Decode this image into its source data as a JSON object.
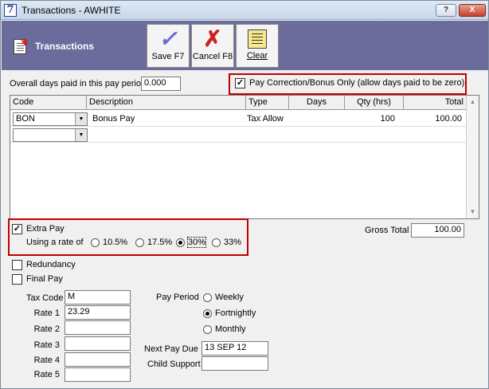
{
  "window": {
    "title": "Transactions - AWHITE",
    "app_glyph": "7",
    "help_glyph": "?",
    "close_glyph": "X"
  },
  "toolbar": {
    "title": "Transactions",
    "save": {
      "label": "Save F7",
      "icon": "checkmark-icon"
    },
    "cancel": {
      "label": "Cancel F8",
      "icon": "cross-icon"
    },
    "clear": {
      "label": "Clear",
      "icon": "clear-sheet-icon"
    }
  },
  "form": {
    "days_paid_label": "Overall days paid in this pay period",
    "days_paid_value": "0.000",
    "pay_correction_label": "Pay Correction/Bonus Only (allow days paid to be zero)",
    "pay_correction_checked": true,
    "gross_total_label": "Gross Total",
    "gross_total_value": "100.00"
  },
  "grid": {
    "columns": [
      "Code",
      "Description",
      "Type",
      "Days",
      "Qty (hrs)",
      "Total"
    ],
    "rows": [
      {
        "code": "BON",
        "description": "Bonus Pay",
        "type": "Tax Allow",
        "days": "",
        "qty": "100",
        "total": "100.00"
      }
    ]
  },
  "extra_pay": {
    "label": "Extra Pay",
    "checked": true,
    "rate_label": "Using a rate of",
    "rates": [
      "10.5%",
      "17.5%",
      "30%",
      "33%"
    ],
    "selected": "30%"
  },
  "options": {
    "redundancy_label": "Redundancy",
    "final_pay_label": "Final Pay"
  },
  "tax": {
    "tax_code_label": "Tax Code",
    "tax_code_value": "M",
    "rates": [
      {
        "label": "Rate 1",
        "value": "23.29"
      },
      {
        "label": "Rate 2",
        "value": ""
      },
      {
        "label": "Rate 3",
        "value": ""
      },
      {
        "label": "Rate 4",
        "value": ""
      },
      {
        "label": "Rate 5",
        "value": ""
      }
    ]
  },
  "pay_period": {
    "label": "Pay Period",
    "options": [
      "Weekly",
      "Fortnightly",
      "Monthly"
    ],
    "selected": "Fortnightly",
    "next_pay_due_label": "Next Pay Due",
    "next_pay_due_value": "13 SEP 12",
    "child_support_label": "Child Support",
    "child_support_value": ""
  }
}
